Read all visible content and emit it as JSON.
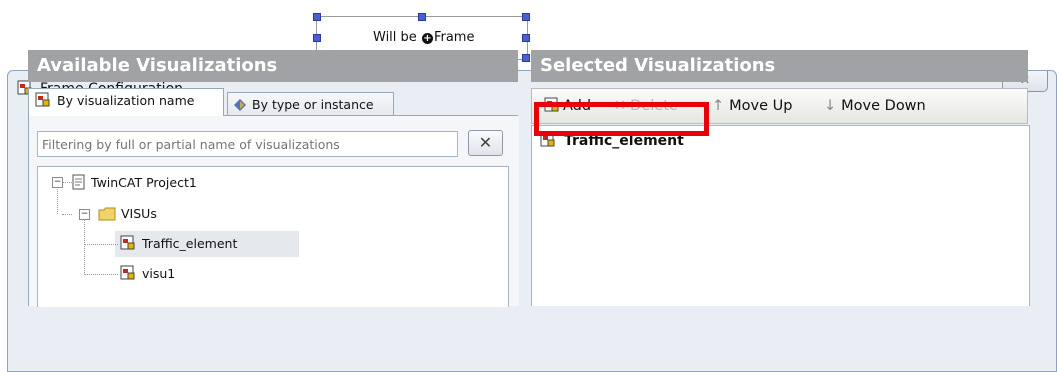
{
  "frame_element": {
    "text_before": "Will be",
    "text_after": "Frame"
  },
  "dialog": {
    "title": "Frame Configuration",
    "close_symbol": "✕",
    "left_panel": {
      "header": "Available Visualizations",
      "tabs": [
        {
          "label": "By visualization name",
          "icon": "visu-icon",
          "active": true
        },
        {
          "label": "By type or instance",
          "icon": "type-instance-icon",
          "active": false
        }
      ],
      "filter_placeholder": "Filtering by full or partial name of visualizations",
      "clear_symbol": "✕",
      "tree": [
        {
          "label": "TwinCAT Project1",
          "icon": "project-icon",
          "level": 0
        },
        {
          "label": "VISUs",
          "icon": "folder-icon",
          "level": 1
        },
        {
          "label": "Traffic_element",
          "icon": "visu-icon",
          "level": 2,
          "selected": true
        },
        {
          "label": "visu1",
          "icon": "visu-icon",
          "level": 2
        }
      ]
    },
    "right_panel": {
      "header": "Selected Visualizations",
      "toolbar": {
        "add": "Add",
        "delete": "Delete",
        "move_up": "Move Up",
        "move_down": "Move Down"
      },
      "selected_items": [
        "Traffic_element"
      ]
    }
  },
  "annotation_color": "#e8000b"
}
